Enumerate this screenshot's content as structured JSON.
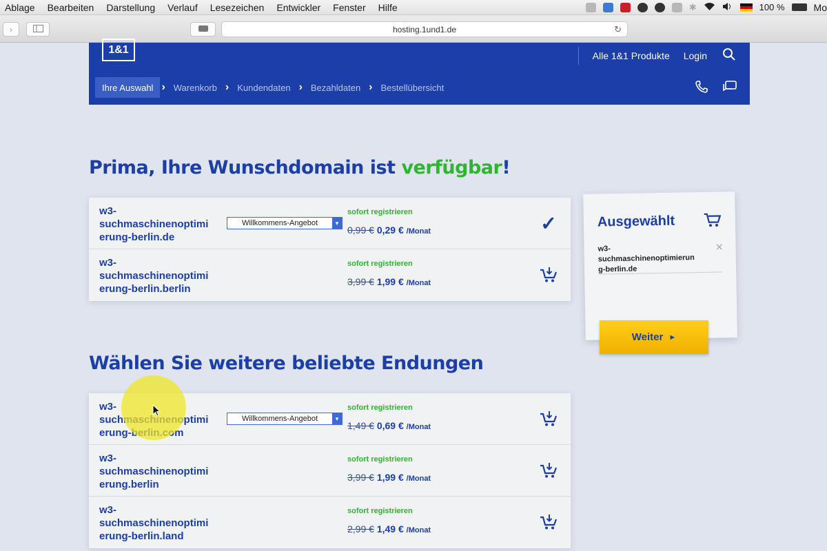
{
  "menubar": {
    "items": [
      "Ablage",
      "Bearbeiten",
      "Darstellung",
      "Verlauf",
      "Lesezeichen",
      "Entwickler",
      "Fenster",
      "Hilfe"
    ],
    "battery": "100 %",
    "clock_fragment": "Mo"
  },
  "browser": {
    "url": "hosting.1und1.de"
  },
  "site": {
    "logo": "1&1",
    "top_links": [
      "Alle 1&1 Produkte",
      "Login"
    ],
    "steps": [
      "Ihre Auswahl",
      "Warenkorb",
      "Kundendaten",
      "Bezahldaten",
      "Bestellübersicht"
    ]
  },
  "headline1": {
    "text": "Prima, Ihre Wunschdomain ist ",
    "highlight": "verfügbar",
    "suffix": "!"
  },
  "headline2": "Wählen Sie weitere beliebte Endungen",
  "primary_domains": [
    {
      "name": "w3-suchmaschinenoptimierung-berlin.de",
      "name_lines": [
        "w3-",
        "suchmaschinenoptimi",
        "erung-berlin.de"
      ],
      "offer": "Willkommens-Angebot",
      "status": "sofort registrieren",
      "old_price": "0,99 €",
      "new_price": "0,29 €",
      "unit": "/Monat",
      "selected": true
    },
    {
      "name": "w3-suchmaschinenoptimierung-berlin.berlin",
      "name_lines": [
        "w3-",
        "suchmaschinenoptimi",
        "erung-berlin.berlin"
      ],
      "offer": "",
      "status": "sofort registrieren",
      "old_price": "3,99 €",
      "new_price": "1,99 €",
      "unit": "/Monat",
      "selected": false
    }
  ],
  "more_domains": [
    {
      "name_lines": [
        "w3-",
        "suchmaschinenoptimi",
        "erung-berlin.com"
      ],
      "offer": "Willkommens-Angebot",
      "status": "sofort registrieren",
      "old_price": "1,49 €",
      "new_price": "0,69 €",
      "unit": "/Monat"
    },
    {
      "name_lines": [
        "w3-",
        "suchmaschinenoptimi",
        "erung.berlin"
      ],
      "offer": "",
      "status": "sofort registrieren",
      "old_price": "3,99 €",
      "new_price": "1,99 €",
      "unit": "/Monat"
    },
    {
      "name_lines": [
        "w3-",
        "suchmaschinenoptimi",
        "erung-berlin.land"
      ],
      "offer": "",
      "status": "sofort registrieren",
      "old_price": "2,99 €",
      "new_price": "1,49 €",
      "unit": "/Monat"
    }
  ],
  "cart": {
    "title": "Ausgewählt",
    "item": "w3-suchmaschinenoptimierung-berlin.de",
    "item_lines": [
      "w3-suchmaschinenoptimierun",
      "g-berlin.de"
    ],
    "button": "Weiter"
  },
  "colors": {
    "brand_blue": "#1b3ea8",
    "available_green": "#2fb52f",
    "button_yellow": "#f7c20a"
  }
}
